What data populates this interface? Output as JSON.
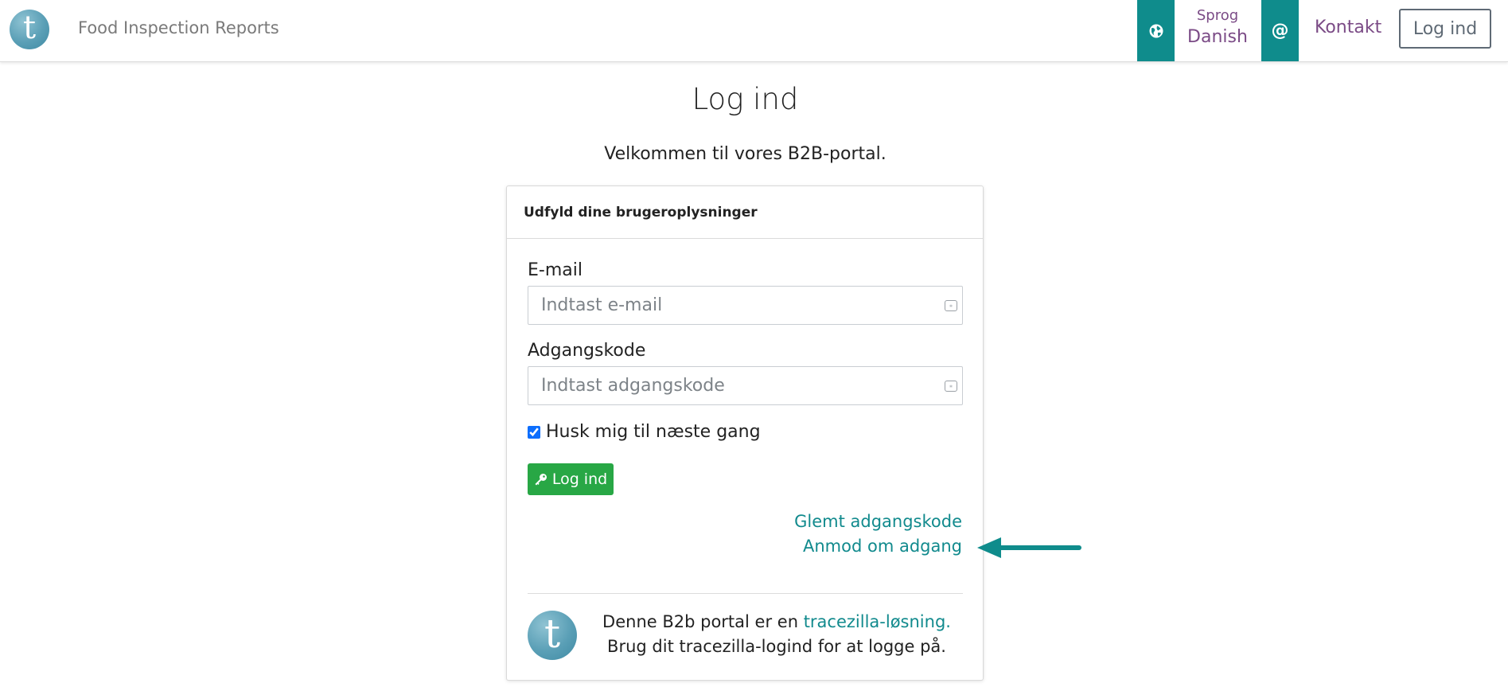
{
  "navbar": {
    "logo_letter": "t",
    "brand_name": "Food Inspection Reports",
    "language": {
      "label": "Sprog",
      "value": "Danish",
      "icon": "globe-icon"
    },
    "contact": {
      "icon_glyph": "@",
      "label": "Kontakt"
    },
    "login_label": "Log ind"
  },
  "page": {
    "title": "Log ind",
    "welcome": "Velkommen til vores B2B-portal."
  },
  "login_card": {
    "header": "Udfyld dine brugeroplysninger",
    "email": {
      "label": "E-mail",
      "placeholder": "Indtast e-mail",
      "value": ""
    },
    "password": {
      "label": "Adgangskode",
      "placeholder": "Indtast adgangskode",
      "value": ""
    },
    "remember": {
      "label": "Husk mig til næste gang",
      "checked": true
    },
    "submit_label": "Log ind",
    "forgot_link": "Glemt adgangskode",
    "request_link": "Anmod om adgang",
    "footer": {
      "logo_letter": "t",
      "text_before": "Denne B2b portal er en ",
      "link_text": "tracezilla-løsning.",
      "text_after": " Brug dit tracezilla-logind for at logge på."
    }
  },
  "colors": {
    "teal": "#0f8c8c",
    "link": "#118a8d",
    "purple": "#7b4b86",
    "success": "#28a745"
  }
}
